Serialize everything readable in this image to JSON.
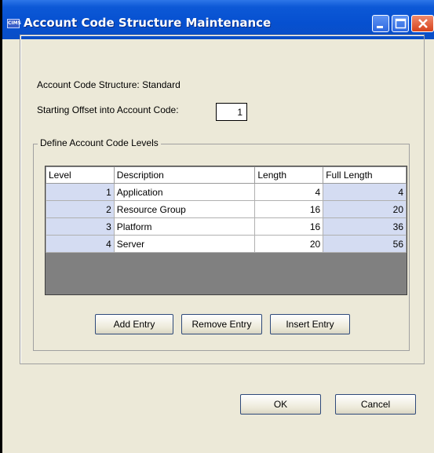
{
  "window": {
    "title": "Account Code Structure Maintenance",
    "icon_text": "CIMS",
    "icon": "app-icon",
    "controls": [
      "minimize-icon",
      "maximize-icon",
      "close-icon"
    ]
  },
  "form": {
    "structure_label": "Account Code Structure: Standard",
    "offset_label": "Starting Offset into Account Code:",
    "offset_value": "1"
  },
  "levels_group": {
    "legend": "Define Account Code Levels",
    "columns": [
      "Level",
      "Description",
      "Length",
      "Full Length"
    ],
    "rows": [
      {
        "level": "1",
        "description": "Application",
        "length": "4",
        "full_length": "4"
      },
      {
        "level": "2",
        "description": "Resource Group",
        "length": "16",
        "full_length": "20"
      },
      {
        "level": "3",
        "description": "Platform",
        "length": "16",
        "full_length": "36"
      },
      {
        "level": "4",
        "description": "Server",
        "length": "20",
        "full_length": "56"
      }
    ],
    "buttons": {
      "add": "Add Entry",
      "remove": "Remove Entry",
      "insert": "Insert Entry"
    }
  },
  "dialog_buttons": {
    "ok": "OK",
    "cancel": "Cancel"
  },
  "colors": {
    "titlebar": "#0650d0",
    "dialog_bg": "#ece9d8",
    "level_cell_bg": "#d4dcf2",
    "table_empty_bg": "#808080"
  }
}
